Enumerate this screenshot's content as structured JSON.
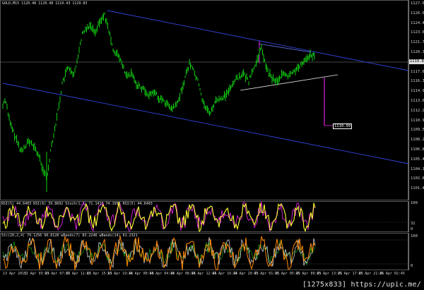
{
  "chart": {
    "title": "GOLD,M15  1120.48 1120.48 1119.43 1119.83",
    "current_price": "1119.83",
    "target_label": "1110.99",
    "price_scale": [
      "1127.00",
      "1126.00",
      "1124.40",
      "1123.00",
      "1121.70",
      "1120.30",
      "1119.00",
      "1117.60",
      "1116.30",
      "1114.90",
      "1113.60",
      "1112.20",
      "1110.90",
      "1109.50",
      "1108.20",
      "1106.80",
      "1105.40",
      "1104.10",
      "1102.80",
      "1101.40"
    ],
    "colors": {
      "candles": "#11cc11",
      "channel": "#3344dd",
      "triangle": "#e8e8e8",
      "target": "#dd22dd",
      "background": "#000000"
    }
  },
  "rsi_panel": {
    "title": "RSI(5) 44.6403  RSI(6) 39.8692  Stoch(1,3) 71.1416 74.1953  RSI(5) 44.6403",
    "scale": [
      "100",
      "32",
      "0"
    ],
    "colors": {
      "main": "#ffff33",
      "secondary": "#dd22dd"
    }
  },
  "stoch_panel": {
    "title": "Stc(20,2,4) 79.1256 90.0128   wBands(7) 83.2246  wBands(14) 61.2321",
    "scale": [
      "100",
      "0"
    ],
    "colors": {
      "fast": "#ff8800",
      "slow": "#cccccc",
      "band": "#11aa11"
    }
  },
  "time_axis": [
    "13 Apr 2015",
    "13 Apr 03:45",
    "13 Apr 07:45",
    "13 Apr 11:45",
    "13 Apr 15:45",
    "13 Apr 19:45",
    "14 Apr 00:45",
    "14 Apr 04:45",
    "14 Apr 08:45",
    "14 Apr 12:45",
    "14 Apr 16:45",
    "14 Apr 20:45",
    "15 Apr 01:45",
    "15 Apr 05:45",
    "15 Apr 09:45",
    "15 Apr 13:45",
    "15 Apr 17:45",
    "15 Apr 21:45",
    "16 Apr 02:45"
  ],
  "watermark": "[1275x833] https://upic.me/"
}
